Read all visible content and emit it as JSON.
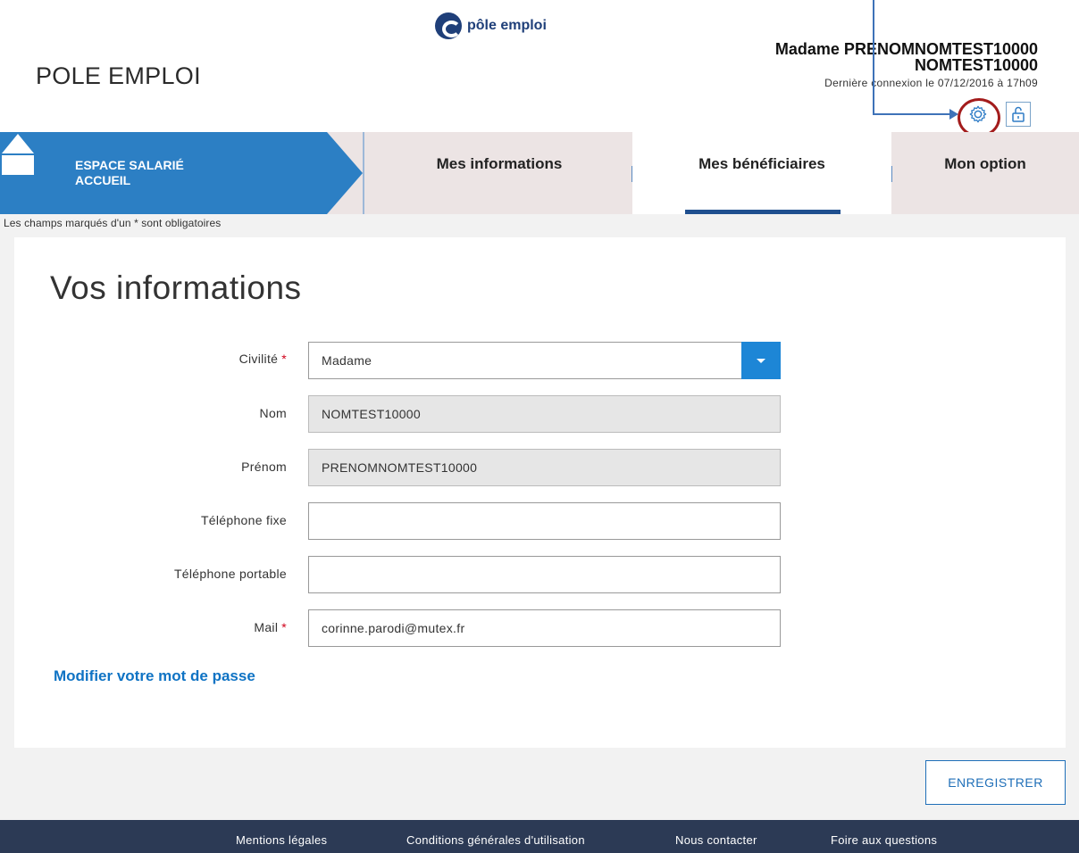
{
  "header": {
    "brand_title": "POLE EMPLOI",
    "logo_text": "pôle emploi",
    "user_name_line1": "Madame PRENOMNOMTEST10000",
    "user_name_line2": "NOMTEST10000",
    "last_connection": "Dernière connexion le 07/12/2016 à 17h09",
    "settings_icon": "gear-icon",
    "unlock_icon": "unlock-icon",
    "highlight_color": "#a31c1c",
    "annotation_color": "#3e72b8"
  },
  "nav": {
    "espace_line1": "ESPACE SALARIÉ",
    "espace_line2": "ACCUEIL",
    "espace_color": "#2c7fc4",
    "tabs": [
      {
        "label": "Mes informations"
      },
      {
        "label": "Mes bénéficiaires"
      },
      {
        "label": "Mon option"
      }
    ]
  },
  "form": {
    "required_note": "Les champs marqués d'un * sont obligatoires",
    "title": "Vos informations",
    "fields": [
      {
        "label": "Civilité",
        "required_mark": "*",
        "value": "Madame"
      },
      {
        "label": "Nom",
        "value": "NOMTEST10000"
      },
      {
        "label": "Prénom",
        "value": "PRENOMNOMTEST10000"
      },
      {
        "label": "Téléphone fixe",
        "value": ""
      },
      {
        "label": "Téléphone portable",
        "value": ""
      },
      {
        "label": "Mail",
        "required_mark": "*",
        "value": "corinne.parodi@mutex.fr"
      }
    ],
    "change_password_link": "Modifier votre mot de passe",
    "save_label": "ENREGISTRER"
  },
  "footer": {
    "links": [
      {
        "label": "Mentions légales"
      },
      {
        "label": "Conditions générales d'utilisation"
      },
      {
        "label": "Nous contacter"
      },
      {
        "label": "Foire aux questions"
      }
    ]
  }
}
